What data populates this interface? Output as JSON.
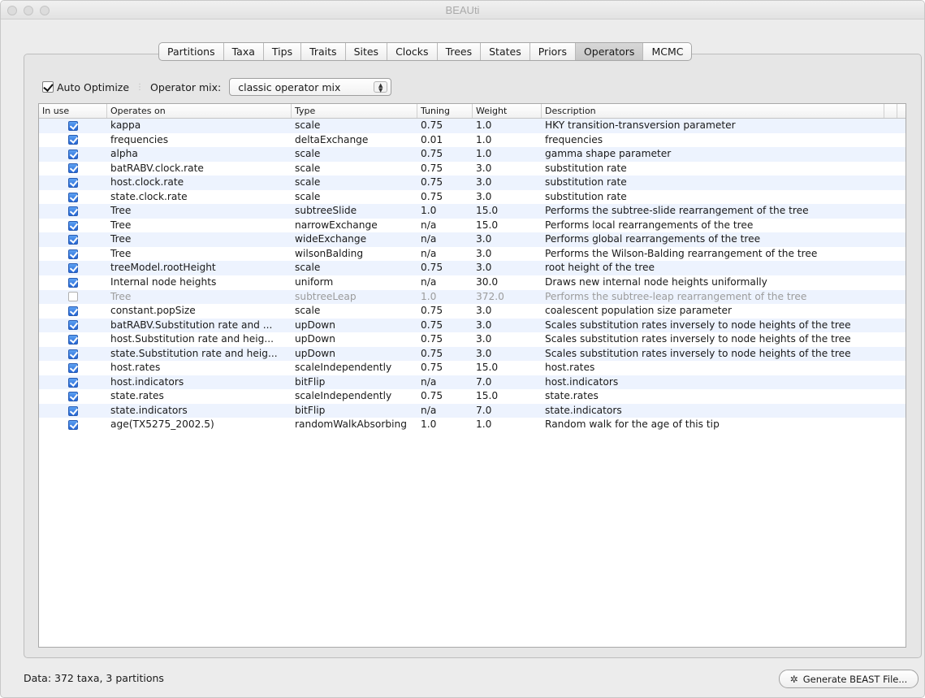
{
  "window": {
    "title": "BEAUti"
  },
  "tabs": [
    {
      "label": "Partitions",
      "selected": false
    },
    {
      "label": "Taxa",
      "selected": false
    },
    {
      "label": "Tips",
      "selected": false
    },
    {
      "label": "Traits",
      "selected": false
    },
    {
      "label": "Sites",
      "selected": false
    },
    {
      "label": "Clocks",
      "selected": false
    },
    {
      "label": "Trees",
      "selected": false
    },
    {
      "label": "States",
      "selected": false
    },
    {
      "label": "Priors",
      "selected": false
    },
    {
      "label": "Operators",
      "selected": true
    },
    {
      "label": "MCMC",
      "selected": false
    }
  ],
  "options": {
    "auto_optimize_label": "Auto Optimize",
    "auto_optimize_checked": true,
    "operator_mix_label": "Operator mix:",
    "operator_mix_value": "classic operator mix"
  },
  "table": {
    "headers": [
      "In use",
      "Operates on",
      "Type",
      "Tuning",
      "Weight",
      "Description"
    ],
    "rows": [
      {
        "in_use": true,
        "operates_on": "kappa",
        "type": "scale",
        "tuning": "0.75",
        "weight": "1.0",
        "description": "HKY transition-transversion parameter"
      },
      {
        "in_use": true,
        "operates_on": "frequencies",
        "type": "deltaExchange",
        "tuning": "0.01",
        "weight": "1.0",
        "description": "frequencies"
      },
      {
        "in_use": true,
        "operates_on": "alpha",
        "type": "scale",
        "tuning": "0.75",
        "weight": "1.0",
        "description": "gamma shape parameter"
      },
      {
        "in_use": true,
        "operates_on": "batRABV.clock.rate",
        "type": "scale",
        "tuning": "0.75",
        "weight": "3.0",
        "description": "substitution rate"
      },
      {
        "in_use": true,
        "operates_on": "host.clock.rate",
        "type": "scale",
        "tuning": "0.75",
        "weight": "3.0",
        "description": "substitution rate"
      },
      {
        "in_use": true,
        "operates_on": "state.clock.rate",
        "type": "scale",
        "tuning": "0.75",
        "weight": "3.0",
        "description": "substitution rate"
      },
      {
        "in_use": true,
        "operates_on": "Tree",
        "type": "subtreeSlide",
        "tuning": "1.0",
        "weight": "15.0",
        "description": "Performs the subtree-slide rearrangement of the tree"
      },
      {
        "in_use": true,
        "operates_on": "Tree",
        "type": "narrowExchange",
        "tuning": "n/a",
        "weight": "15.0",
        "description": "Performs local rearrangements of the tree"
      },
      {
        "in_use": true,
        "operates_on": "Tree",
        "type": "wideExchange",
        "tuning": "n/a",
        "weight": "3.0",
        "description": "Performs global rearrangements of the tree"
      },
      {
        "in_use": true,
        "operates_on": "Tree",
        "type": "wilsonBalding",
        "tuning": "n/a",
        "weight": "3.0",
        "description": "Performs the Wilson-Balding rearrangement of the tree"
      },
      {
        "in_use": true,
        "operates_on": "treeModel.rootHeight",
        "type": "scale",
        "tuning": "0.75",
        "weight": "3.0",
        "description": "root height of the tree"
      },
      {
        "in_use": true,
        "operates_on": "Internal node heights",
        "type": "uniform",
        "tuning": "n/a",
        "weight": "30.0",
        "description": "Draws new internal node heights uniformally"
      },
      {
        "in_use": false,
        "operates_on": "Tree",
        "type": "subtreeLeap",
        "tuning": "1.0",
        "weight": "372.0",
        "description": "Performs the subtree-leap rearrangement of the tree"
      },
      {
        "in_use": true,
        "operates_on": "constant.popSize",
        "type": "scale",
        "tuning": "0.75",
        "weight": "3.0",
        "description": "coalescent population size parameter"
      },
      {
        "in_use": true,
        "operates_on": "batRABV.Substitution rate and ...",
        "type": "upDown",
        "tuning": "0.75",
        "weight": "3.0",
        "description": "Scales substitution rates inversely to node heights of the tree"
      },
      {
        "in_use": true,
        "operates_on": "host.Substitution rate and heig...",
        "type": "upDown",
        "tuning": "0.75",
        "weight": "3.0",
        "description": "Scales substitution rates inversely to node heights of the tree"
      },
      {
        "in_use": true,
        "operates_on": "state.Substitution rate and heig...",
        "type": "upDown",
        "tuning": "0.75",
        "weight": "3.0",
        "description": "Scales substitution rates inversely to node heights of the tree"
      },
      {
        "in_use": true,
        "operates_on": "host.rates",
        "type": "scaleIndependently",
        "tuning": "0.75",
        "weight": "15.0",
        "description": "host.rates"
      },
      {
        "in_use": true,
        "operates_on": "host.indicators",
        "type": "bitFlip",
        "tuning": "n/a",
        "weight": "7.0",
        "description": "host.indicators"
      },
      {
        "in_use": true,
        "operates_on": "state.rates",
        "type": "scaleIndependently",
        "tuning": "0.75",
        "weight": "15.0",
        "description": "state.rates"
      },
      {
        "in_use": true,
        "operates_on": "state.indicators",
        "type": "bitFlip",
        "tuning": "n/a",
        "weight": "7.0",
        "description": "state.indicators"
      },
      {
        "in_use": true,
        "operates_on": "age(TX5275_2002.5)",
        "type": "randomWalkAbsorbing",
        "tuning": "1.0",
        "weight": "1.0",
        "description": "Random walk for the age of this tip"
      }
    ]
  },
  "status": {
    "text": "Data: 372 taxa, 3 partitions"
  },
  "generate_button": {
    "label": "Generate BEAST File..."
  },
  "icons": {
    "gear": "gear-icon",
    "select_arrows": "updown-arrows-icon"
  }
}
